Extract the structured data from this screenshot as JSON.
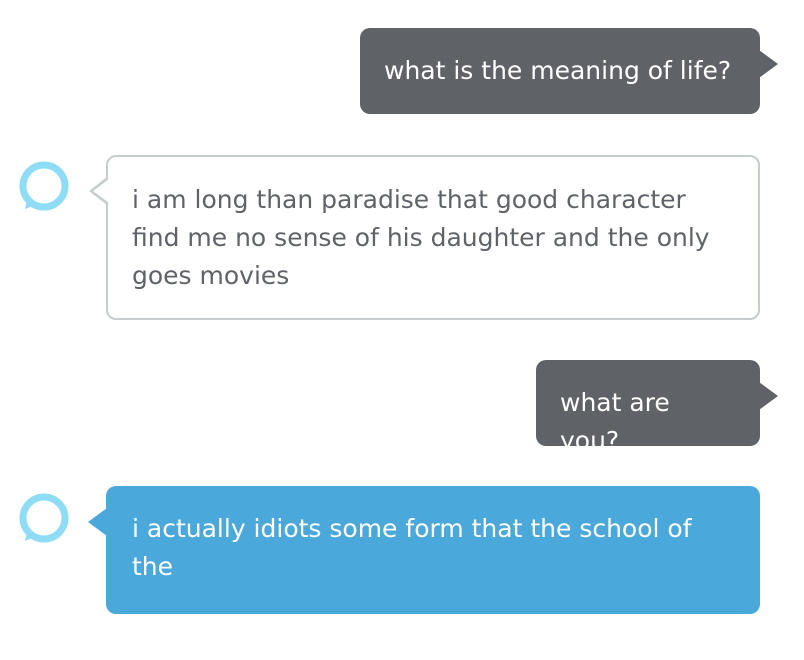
{
  "conversation": {
    "accent_color": "#4aa8da",
    "avatar_icon": "alexa-ring-icon",
    "messages": [
      {
        "role": "user",
        "text": "what is the meaning of life?"
      },
      {
        "role": "assistant",
        "text": "i am long than paradise that good character find me no sense of his daughter and the only goes movies"
      },
      {
        "role": "user",
        "text": "what are you?"
      },
      {
        "role": "assistant",
        "text": "i actually idiots some form that the school of the"
      }
    ]
  }
}
